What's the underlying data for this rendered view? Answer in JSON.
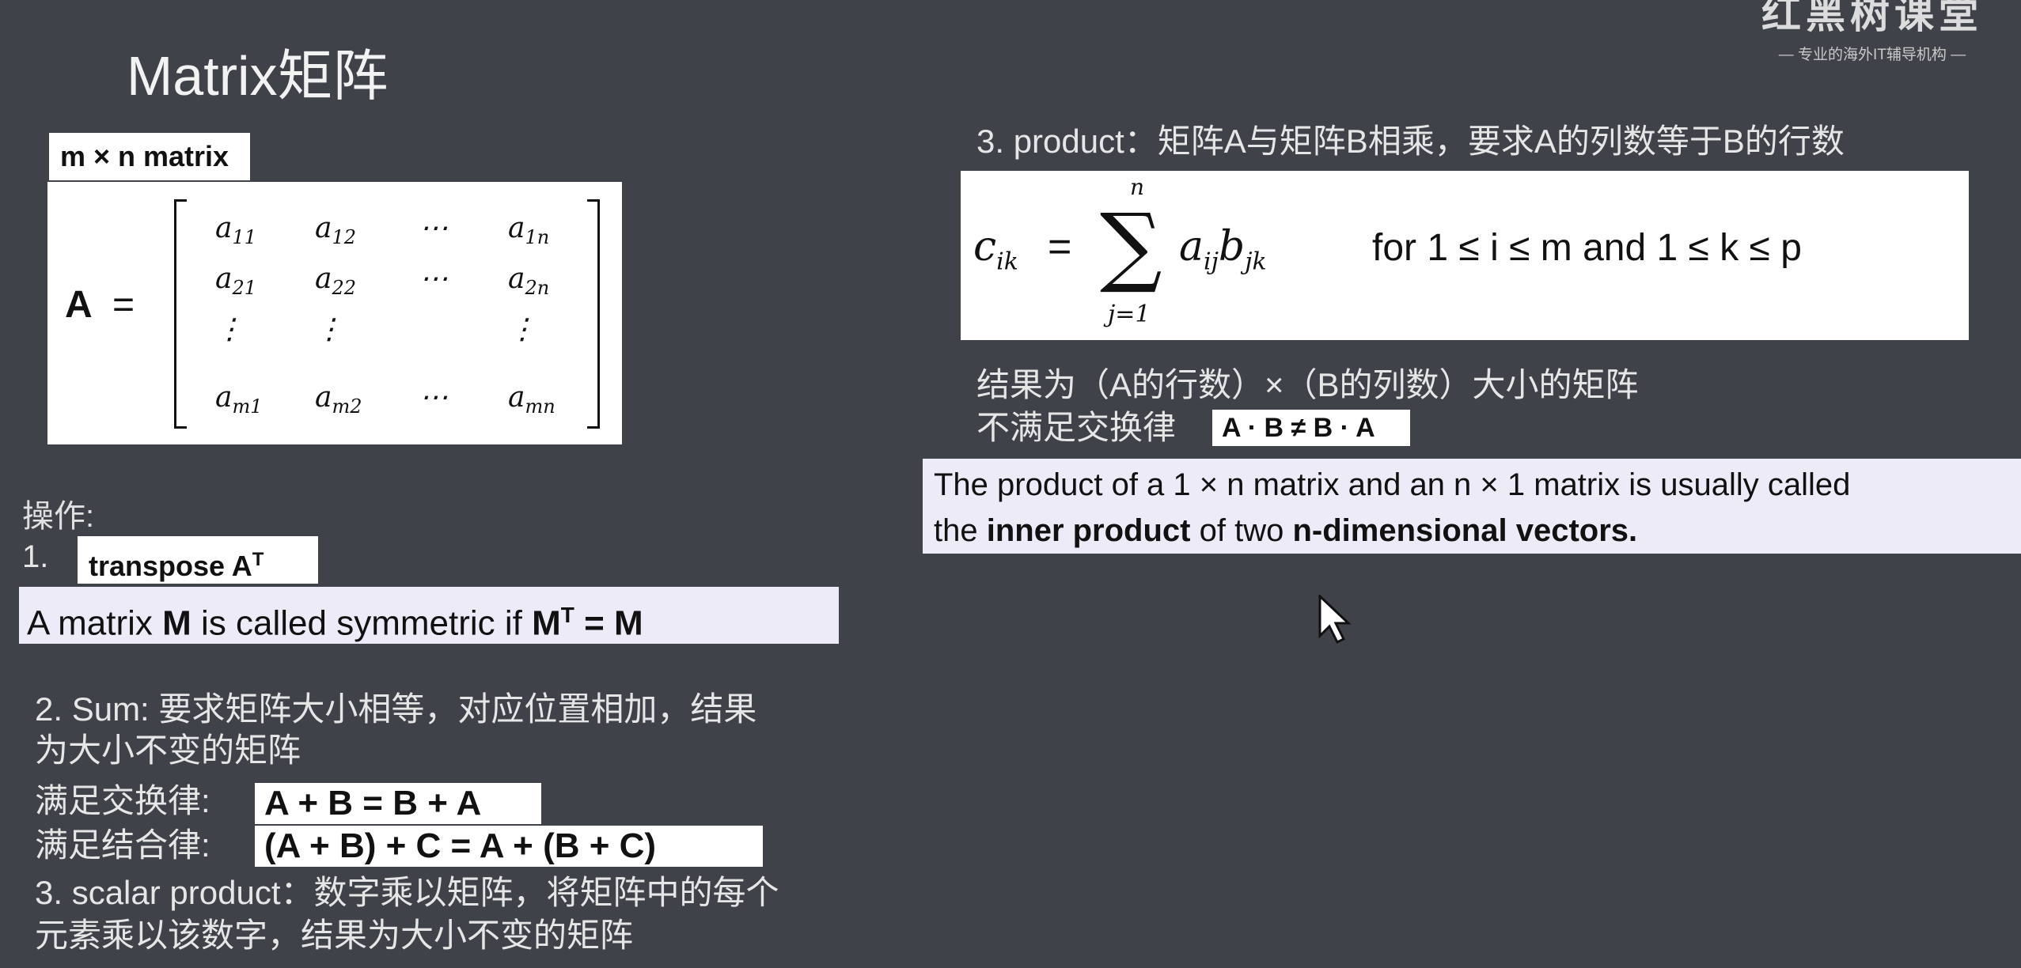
{
  "slide": {
    "title": "Matrix矩阵",
    "logo": {
      "main": "红黑树课堂",
      "sub": "— 专业的海外IT辅导机构 —"
    }
  },
  "left": {
    "matrix_label": "m × n matrix",
    "matrix_lhs": "A",
    "matrix_eq": "=",
    "matrix_cells": [
      [
        "a",
        "11"
      ],
      [
        "a",
        "12"
      ],
      [
        "⋯",
        ""
      ],
      [
        "a",
        "1n"
      ],
      [
        "a",
        "21"
      ],
      [
        "a",
        "22"
      ],
      [
        "⋯",
        ""
      ],
      [
        "a",
        "2n"
      ],
      [
        "⋮",
        ""
      ],
      [
        "⋮",
        ""
      ],
      [
        "⋮",
        ""
      ],
      [
        "a",
        "m1"
      ],
      [
        "a",
        "m2"
      ],
      [
        "⋯",
        ""
      ],
      [
        "a",
        "mn"
      ]
    ],
    "ops_label": "操作:",
    "item1_num": "1.",
    "transpose_label": "transpose A",
    "transpose_sup": "T",
    "symmetric_text": "A matrix ",
    "symmetric_M": "M",
    "symmetric_mid": " is called symmetric if ",
    "symmetric_eq_lhs": "M",
    "symmetric_eq_sup": "T",
    "symmetric_eq_rhs": " = M",
    "sum_line1": "2. Sum: 要求矩阵大小相等，对应位置相加，结果",
    "sum_line2": "为大小不变的矩阵",
    "commutative_label": "满足交换律:",
    "commutative_eq": "A + B = B + A",
    "associative_label": "满足结合律:",
    "associative_eq": "(A + B) + C = A + (B + C)",
    "scalar_line1": "3. scalar product：数字乘以矩阵，将矩阵中的每个",
    "scalar_line2": "元素乘以该数字，结果为大小不变的矩阵"
  },
  "right": {
    "product_heading": "3. product：矩阵A与矩阵B相乘，要求A的列数等于B的行数",
    "formula_lhs": "c",
    "formula_lhs_sub": "ik",
    "formula_eq": "=",
    "formula_sum_top": "n",
    "formula_sum_bottom": "j=1",
    "formula_term_a": "a",
    "formula_term_a_sub": "ij",
    "formula_term_b": "b",
    "formula_term_b_sub": "jk",
    "formula_condition": "for 1 ≤ i ≤ m and 1 ≤ k ≤ p",
    "result_line": "结果为（A的行数）×（B的列数）大小的矩阵",
    "noncommutative_label": "不满足交换律",
    "noncommutative_eq": "A · B ≠ B · A",
    "inner_line1": "The product of a 1 × n matrix and an n × 1 matrix is usually called",
    "inner_line2_a": "the ",
    "inner_line2_bold": "inner product",
    "inner_line2_b": " of two ",
    "inner_line2_bold2": "n-dimensional vectors."
  }
}
